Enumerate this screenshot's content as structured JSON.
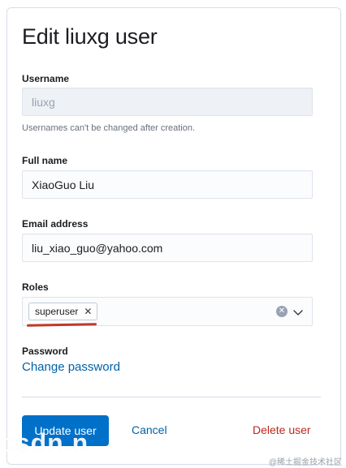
{
  "form": {
    "title": "Edit liuxg user",
    "username": {
      "label": "Username",
      "value": "liuxg",
      "help": "Usernames can't be changed after creation."
    },
    "full_name": {
      "label": "Full name",
      "value": "XiaoGuo Liu"
    },
    "email": {
      "label": "Email address",
      "value": "liu_xiao_guo@yahoo.com"
    },
    "roles": {
      "label": "Roles",
      "chips": [
        "superuser"
      ],
      "chip_remove_glyph": "✕",
      "clear_glyph": "✕"
    },
    "password": {
      "label": "Password",
      "change_link": "Change password"
    },
    "actions": {
      "update": "Update user",
      "cancel": "Cancel",
      "delete": "Delete user"
    }
  },
  "watermarks": {
    "csdn": "csdn.n",
    "juejin": "@稀土掘金技术社区"
  },
  "colors": {
    "primary": "#0070c9",
    "link": "#0061a6",
    "danger": "#bd271e",
    "annotation_underline": "#c0392b"
  },
  "icons": {
    "chip_remove": "close-icon",
    "combo_clear": "clear-circle-icon",
    "combo_toggle": "chevron-down-icon"
  }
}
